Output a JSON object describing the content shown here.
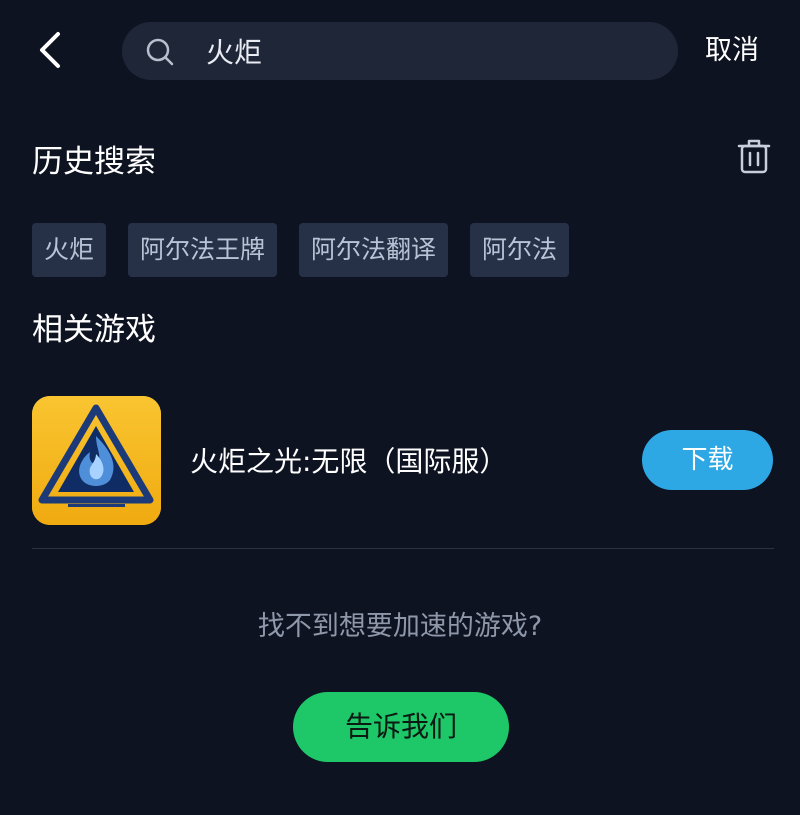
{
  "header": {
    "back_icon": "chevron-left-icon",
    "search_icon": "search-icon",
    "search_value": "火炬",
    "cancel_label": "取消"
  },
  "history": {
    "title": "历史搜索",
    "clear_icon": "trash-icon",
    "tags": [
      "火炬",
      "阿尔法王牌",
      "阿尔法翻译",
      "阿尔法"
    ]
  },
  "related": {
    "title": "相关游戏",
    "games": [
      {
        "name": "火炬之光:无限（国际服）",
        "icon": "torchlight-game-icon",
        "download_label": "下载"
      }
    ]
  },
  "footer": {
    "hint": "找不到想要加速的游戏?",
    "tell_us_label": "告诉我们"
  },
  "colors": {
    "background": "#0e1322",
    "search_bg": "#1e2638",
    "tag_bg": "#263147",
    "download_blue": "#2ea8e5",
    "tell_green": "#1ec868",
    "game_icon_yellow": "#f6b921"
  }
}
